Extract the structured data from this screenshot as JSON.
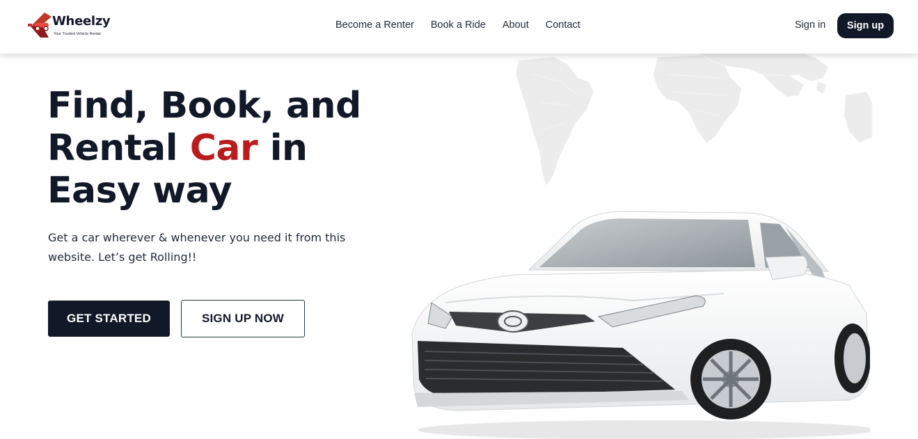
{
  "brand": {
    "name": "Wheelzy",
    "tagline": "Your Trusted Vehicle Rental",
    "accent_color": "#b91c1c",
    "dark_color": "#111827"
  },
  "nav": {
    "links": [
      {
        "label": "Become a Renter"
      },
      {
        "label": "Book a Ride"
      },
      {
        "label": "About"
      },
      {
        "label": "Contact"
      }
    ],
    "sign_in": "Sign in",
    "sign_up": "Sign up"
  },
  "hero": {
    "title_line1": "Find, Book, and",
    "title_line2_before": "Rental ",
    "title_line2_accent": "Car",
    "title_line2_after": " in",
    "title_line3": "Easy way",
    "subtitle": "Get a car wherever & whenever you need it from this website. Let’s get Rolling!!",
    "cta_primary": "GET STARTED",
    "cta_secondary": "SIGN UP NOW"
  },
  "images": {
    "map": "world-map",
    "car": "white-sedan"
  }
}
